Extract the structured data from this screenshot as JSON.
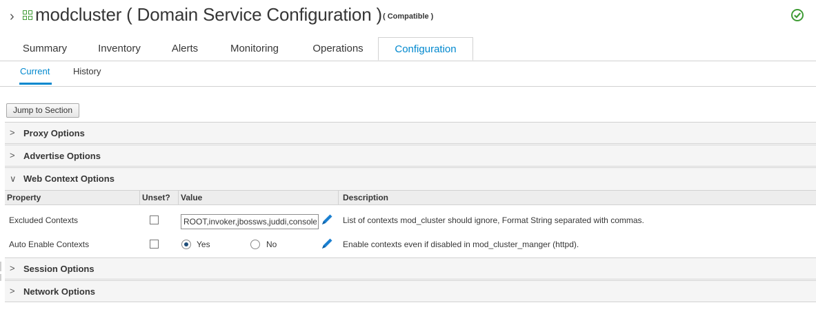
{
  "header": {
    "title": "modcluster ( Domain Service Configuration )",
    "compat": "( Compatible )",
    "status_icon": "check-circle-icon",
    "resource_icon": "grid-icon",
    "accent_green": "#3f9c35"
  },
  "tabs": [
    {
      "label": "Summary"
    },
    {
      "label": "Inventory"
    },
    {
      "label": "Alerts"
    },
    {
      "label": "Monitoring"
    },
    {
      "label": "Operations"
    },
    {
      "label": "Configuration",
      "active": true
    }
  ],
  "subtabs": [
    {
      "label": "Current",
      "active": true
    },
    {
      "label": "History"
    }
  ],
  "jump_label": "Jump to Section",
  "sections": {
    "proxy": "Proxy Options",
    "advertise": "Advertise Options",
    "web_context": "Web Context Options",
    "session": "Session Options",
    "network": "Network Options"
  },
  "table": {
    "headers": {
      "property": "Property",
      "unset": "Unset?",
      "value": "Value",
      "description": "Description"
    },
    "rows": [
      {
        "property": "Excluded Contexts",
        "value": "ROOT,invoker,jbossws,juddi,console",
        "description": "List of contexts mod_cluster should ignore, Format String separated with commas."
      },
      {
        "property": "Auto Enable Contexts",
        "yes_label": "Yes",
        "no_label": "No",
        "selected": "Yes",
        "description": "Enable contexts even if disabled in mod_cluster_manger (httpd)."
      }
    ]
  },
  "accent_color": "#0088ce"
}
